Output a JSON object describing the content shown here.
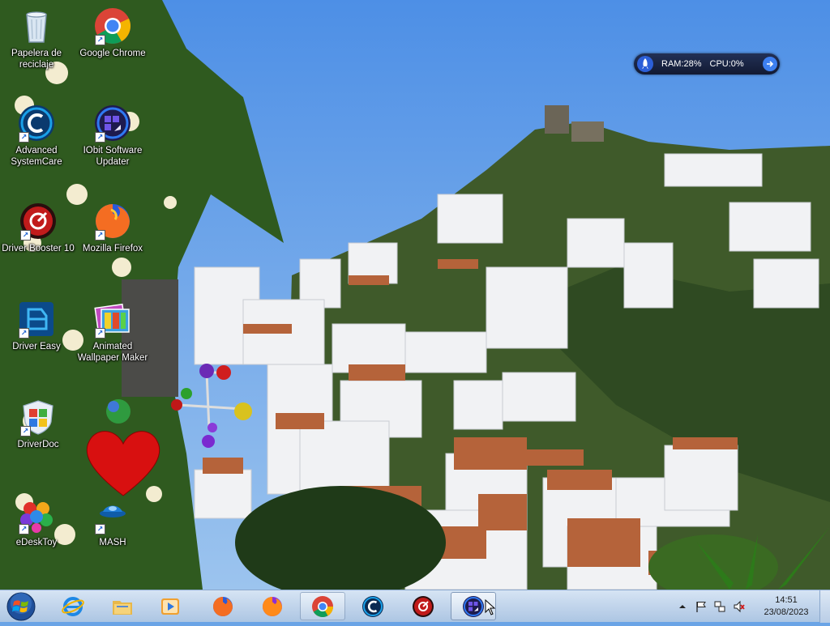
{
  "desktop": {
    "icons": [
      {
        "label": "Papelera de reciclaje",
        "icon": "recycle-bin-icon"
      },
      {
        "label": "Google Chrome",
        "icon": "chrome-icon"
      },
      {
        "label": "Advanced SystemCare",
        "icon": "advanced-systemcare-icon"
      },
      {
        "label": "IObit Software Updater",
        "icon": "software-updater-icon"
      },
      {
        "label": "Driver Booster 10",
        "icon": "driver-booster-icon"
      },
      {
        "label": "Mozilla Firefox",
        "icon": "firefox-icon"
      },
      {
        "label": "Driver Easy",
        "icon": "driver-easy-icon"
      },
      {
        "label": "Animated Wallpaper Maker",
        "icon": "wallpaper-maker-icon"
      },
      {
        "label": "DriverDoc",
        "icon": "driverdoc-icon"
      },
      {
        "label": "eDeskToy",
        "icon": "edesktoy-icon"
      },
      {
        "label": "MASH",
        "icon": "mash-icon"
      }
    ]
  },
  "widget": {
    "ram": "RAM:28%",
    "cpu": "CPU:0%"
  },
  "taskbar": {
    "pinned": [
      {
        "name": "internet-explorer-icon"
      },
      {
        "name": "file-explorer-icon"
      },
      {
        "name": "media-player-icon"
      },
      {
        "name": "firefox-icon"
      },
      {
        "name": "firefox-alt-icon"
      },
      {
        "name": "chrome-icon",
        "state": "running"
      },
      {
        "name": "advanced-systemcare-icon"
      },
      {
        "name": "driver-booster-icon"
      },
      {
        "name": "software-updater-icon",
        "state": "active"
      }
    ],
    "clock": {
      "time": "14:51",
      "date": "23/08/2023"
    }
  },
  "colors": {
    "accent": "#3d7ff0",
    "taskbar": "#c3d6ec",
    "sky": "#6aa4e6"
  }
}
